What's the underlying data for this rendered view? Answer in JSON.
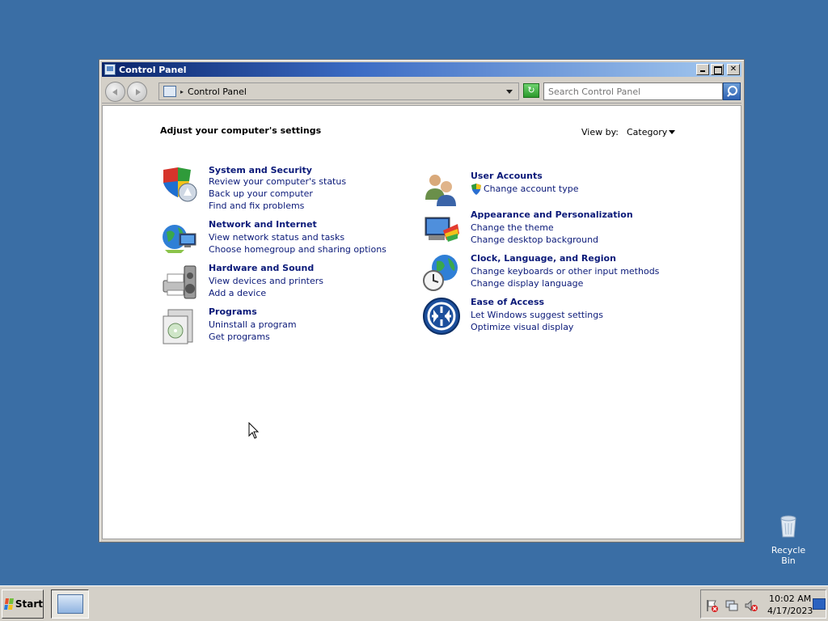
{
  "window": {
    "title": "Control Panel",
    "buttons": {
      "minimize": "",
      "maximize": "",
      "close": "✕"
    }
  },
  "address_bar": {
    "path": "Control Panel",
    "search_placeholder": "Search Control Panel"
  },
  "content": {
    "heading": "Adjust your computer's settings",
    "view_by_label": "View by:",
    "view_by_value": "Category"
  },
  "categories": [
    {
      "title": "System and Security",
      "icon": "shield-icon",
      "links": [
        "Review your computer's status",
        "Back up your computer",
        "Find and fix problems"
      ]
    },
    {
      "title": "Network and Internet",
      "icon": "network-globe-icon",
      "links": [
        "View network status and tasks",
        "Choose homegroup and sharing options"
      ]
    },
    {
      "title": "Hardware and Sound",
      "icon": "printer-speaker-icon",
      "links": [
        "View devices and printers",
        "Add a device"
      ]
    },
    {
      "title": "Programs",
      "icon": "programs-box-icon",
      "links": [
        "Uninstall a program",
        "Get programs"
      ]
    },
    {
      "title": "User Accounts",
      "icon": "users-icon",
      "links": [
        "Change account type"
      ]
    },
    {
      "title": "Appearance and Personalization",
      "icon": "monitor-palette-icon",
      "links": [
        "Change the theme",
        "Change desktop background"
      ]
    },
    {
      "title": "Clock, Language, and Region",
      "icon": "globe-clock-icon",
      "links": [
        "Change keyboards or other input methods",
        "Change display language"
      ]
    },
    {
      "title": "Ease of Access",
      "icon": "ease-of-access-icon",
      "links": [
        "Let Windows suggest settings",
        "Optimize visual display"
      ]
    }
  ],
  "desktop": {
    "recycle_bin_label": "Recycle Bin"
  },
  "taskbar": {
    "start_label": "Start",
    "time": "10:02 AM",
    "date": "4/17/2023"
  }
}
